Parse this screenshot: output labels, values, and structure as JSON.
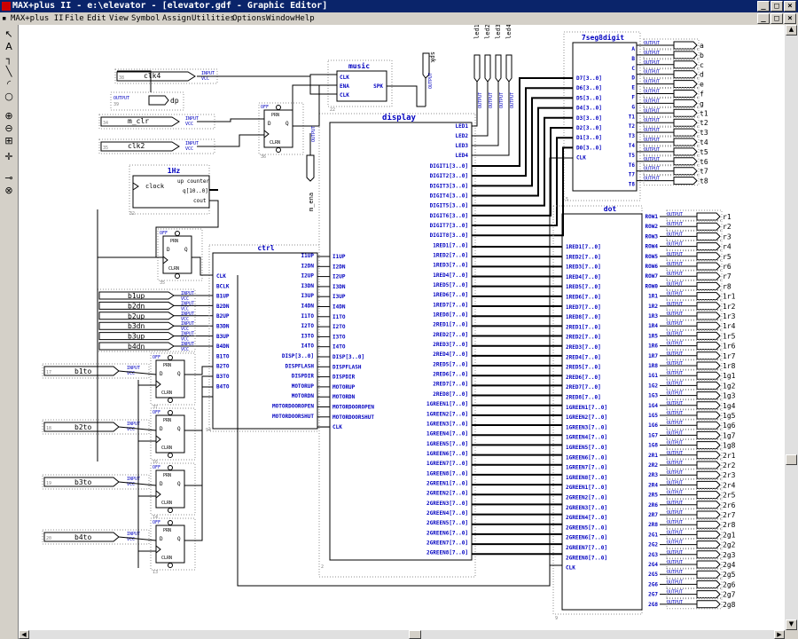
{
  "window": {
    "title": "MAX+plus II - e:\\elevator - [elevator.gdf - Graphic Editor]",
    "ctrl_min": "_",
    "ctrl_max": "□",
    "ctrl_close": "×"
  },
  "menu": [
    "MAX+plus II",
    "File",
    "Edit",
    "View",
    "Symbol",
    "Assign",
    "Utilities",
    "Options",
    "Window",
    "Help"
  ],
  "toolbox": [
    "arrow-tool",
    "text-tool",
    "orthogonal-line-tool",
    "diagonal-line-tool",
    "arc-tool",
    "circle-tool",
    "zoom-in-tool",
    "zoom-out-tool",
    "fit-window-tool",
    "rubberband-tool",
    "connect-tool",
    "disconnect-tool"
  ],
  "toolbox_glyphs": [
    "↖",
    "A",
    "┐",
    "╲",
    "◜",
    "○",
    "⊕",
    "⊖",
    "⊞",
    "✛",
    "⊸",
    "⊗"
  ],
  "schematic": {
    "input_label": "INPUT",
    "vcc_label": "VCC",
    "output_label": "OUTPUT",
    "dff": {
      "d": "D",
      "prn": "PRN",
      "clrn": "CLRN",
      "q": "Q",
      "off": "OFF"
    },
    "inputs_top": [
      {
        "name": "clk4",
        "num": "38"
      },
      {
        "name": "m_clr",
        "num": "34"
      },
      {
        "name": "clk2",
        "num": "35"
      }
    ],
    "output_dp": {
      "name": "dp",
      "num": "39"
    },
    "spk_label": "spk",
    "m_ena_label": "m_ena",
    "led_labels": [
      "led1",
      "led2",
      "led3",
      "led4"
    ],
    "music": {
      "title": "music",
      "pins_left": [
        "CLK",
        "ENA",
        "CLK"
      ],
      "pin_right": "SPK",
      "num": "22"
    },
    "counter": {
      "title": "1Hz",
      "subtitle": "up counter",
      "clock": "clock",
      "q": "q[10..0]",
      "cout": "cout",
      "num": "32"
    },
    "ctrl": {
      "title": "ctrl",
      "left": [
        "CLK",
        "BCLK",
        "B1UP",
        "B2DN",
        "B2UP",
        "B3DN",
        "B3UP",
        "B4DN",
        "B1TO",
        "B2TO",
        "B3TO",
        "B4TO"
      ],
      "right": [
        "I1UP",
        "I2DN",
        "I2UP",
        "I3DN",
        "I3UP",
        "I4DN",
        "I1TO",
        "I2TO",
        "I3TO",
        "I4TO",
        "DISP[3..0]",
        "DISPFLASH",
        "DISPDIR",
        "MOTORUP",
        "MOTORDN",
        "MOTORDOOROPEN",
        "MOTORDOORSHUT"
      ],
      "num": "94"
    },
    "button_inputs": [
      "b1up",
      "b2dn",
      "b2up",
      "b3dn",
      "b3up",
      "b4dn"
    ],
    "to_inputs": [
      {
        "name": "b1to",
        "num": "17"
      },
      {
        "name": "b2to",
        "num": "18"
      },
      {
        "name": "b3to",
        "num": "19"
      },
      {
        "name": "b4to",
        "num": "20"
      }
    ],
    "dff_nums": [
      "36",
      "35",
      "37",
      "16",
      "14",
      "13"
    ],
    "display": {
      "title": "display",
      "left": [
        "I1UP",
        "I2DN",
        "I2UP",
        "I3DN",
        "I3UP",
        "I4DN",
        "I1TO",
        "I2TO",
        "I3TO",
        "I4TO",
        "DISP[3..0]",
        "DISPFLASH",
        "DISPDIR",
        "MOTORUP",
        "MOTORDN",
        "MOTORDOOROPEN",
        "MOTORDOORSHUT",
        "CLK"
      ],
      "right_leds": [
        "LED1",
        "LED2",
        "LED3",
        "LED4"
      ],
      "right_buses": [
        "DIGIT1[3..0]",
        "DIGIT2[3..0]",
        "DIGIT3[3..0]",
        "DIGIT4[3..0]",
        "DIGIT5[3..0]",
        "DIGIT6[3..0]",
        "DIGIT7[3..0]",
        "DIGIT8[3..0]",
        "1RED1[7..0]",
        "1RED2[7..0]",
        "1RED3[7..0]",
        "1RED4[7..0]",
        "1RED5[7..0]",
        "1RED6[7..0]",
        "1RED7[7..0]",
        "1RED8[7..0]",
        "2RED1[7..0]",
        "2RED2[7..0]",
        "2RED3[7..0]",
        "2RED4[7..0]",
        "2RED5[7..0]",
        "2RED6[7..0]",
        "2RED7[7..0]",
        "2RED8[7..0]",
        "1GREEN1[7..0]",
        "1GREEN2[7..0]",
        "1GREEN3[7..0]",
        "1GREEN4[7..0]",
        "1GREEN5[7..0]",
        "1GREEN6[7..0]",
        "1GREEN7[7..0]",
        "1GREEN8[7..0]",
        "2GREEN1[7..0]",
        "2GREEN2[7..0]",
        "2GREEN3[7..0]",
        "2GREEN4[7..0]",
        "2GREEN5[7..0]",
        "2GREEN6[7..0]",
        "2GREEN7[7..0]",
        "2GREEN8[7..0]"
      ]
    },
    "seg": {
      "title": "7seg8digit",
      "left": [
        "D7[3..0]",
        "D6[3..0]",
        "D5[3..0]",
        "D4[3..0]",
        "D3[3..0]",
        "D2[3..0]",
        "D1[3..0]",
        "D0[3..0]",
        "CLK"
      ],
      "right": [
        "A",
        "B",
        "C",
        "D",
        "E",
        "F",
        "G",
        "T1",
        "T2",
        "T3",
        "T4",
        "T5",
        "T6",
        "T7",
        "T8"
      ],
      "outputs": [
        "a",
        "b",
        "c",
        "d",
        "e",
        "f",
        "g",
        "t1",
        "t2",
        "t3",
        "t4",
        "t5",
        "t6",
        "t7",
        "t8"
      ],
      "num": "5"
    },
    "dot": {
      "title": "dot",
      "left": [
        "1RED1[7..0]",
        "1RED2[7..0]",
        "1RED3[7..0]",
        "1RED4[7..0]",
        "1RED5[7..0]",
        "1RED6[7..0]",
        "1RED7[7..0]",
        "1RED8[7..0]",
        "2RED1[7..0]",
        "2RED2[7..0]",
        "2RED3[7..0]",
        "2RED4[7..0]",
        "2RED5[7..0]",
        "2RED6[7..0]",
        "2RED7[7..0]",
        "2RED8[7..0]",
        "1GREEN1[7..0]",
        "1GREEN2[7..0]",
        "1GREEN3[7..0]",
        "1GREEN4[7..0]",
        "1GREEN5[7..0]",
        "1GREEN6[7..0]",
        "1GREEN7[7..0]",
        "1GREEN8[7..0]",
        "2GREEN1[7..0]",
        "2GREEN2[7..0]",
        "2GREEN3[7..0]",
        "2GREEN4[7..0]",
        "2GREEN5[7..0]",
        "2GREEN6[7..0]",
        "2GREEN7[7..0]",
        "2GREEN8[7..0]",
        "CLK"
      ],
      "right": [
        "ROW1",
        "ROW2",
        "ROW3",
        "ROW4",
        "ROW5",
        "ROW6",
        "ROW7",
        "ROW0",
        "1R1",
        "1R2",
        "1R3",
        "1R4",
        "1R5",
        "1R6",
        "1R7",
        "1R8",
        "1G1",
        "1G2",
        "1G3",
        "1G4",
        "1G5",
        "1G6",
        "1G7",
        "1G8",
        "2R1",
        "2R2",
        "2R3",
        "2R4",
        "2R5",
        "2R6",
        "2R7",
        "2R8",
        "2G1",
        "2G2",
        "2G3",
        "2G4",
        "2G5",
        "2G6",
        "2G7",
        "2G8"
      ],
      "outputs": [
        "r1",
        "r2",
        "r3",
        "r4",
        "r5",
        "r6",
        "r7",
        "r8",
        "1r1",
        "1r2",
        "1r3",
        "1r4",
        "1r5",
        "1r6",
        "1r7",
        "1r8",
        "1g1",
        "1g2",
        "1g3",
        "1g4",
        "1g5",
        "1g6",
        "1g7",
        "1g8",
        "2r1",
        "2r2",
        "2r3",
        "2r4",
        "2r5",
        "2r6",
        "2r7",
        "2r8",
        "2g1",
        "2g2",
        "2g3",
        "2g4",
        "2g5",
        "2g6",
        "2g7",
        "2g8"
      ],
      "num": "9"
    }
  },
  "colors": {
    "title_bg": "#0a246a",
    "pin_text": "#0000c0",
    "symbol_title": "#0000c0",
    "wire": "#000000",
    "io_text": "#0000c0",
    "dotted": "#909090"
  }
}
